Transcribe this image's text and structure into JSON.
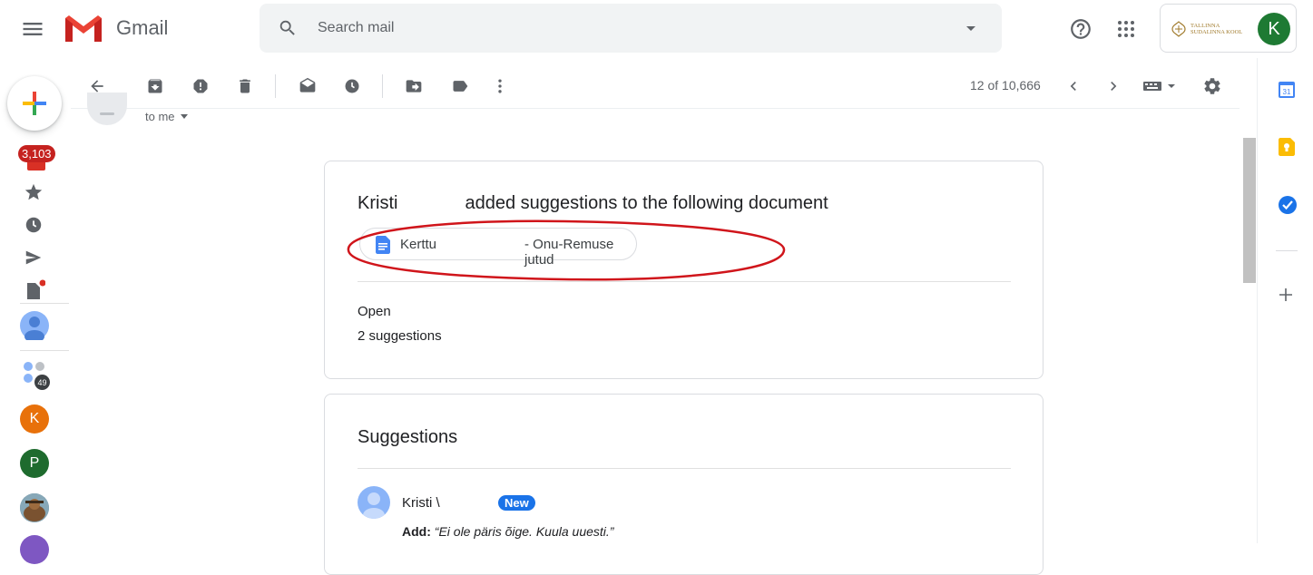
{
  "app": {
    "name": "Gmail",
    "brand_red": "#EA4335",
    "accent_blue": "#1a73e8"
  },
  "header": {
    "logo_text": "Gmail",
    "search_placeholder": "Search mail",
    "icons": [
      "main-menu-icon",
      "search-icon",
      "search-options-icon",
      "help-icon",
      "apps-icon"
    ],
    "org_logo_line1": "TALLINNA",
    "org_logo_line2": "SUDALINNA KOOL",
    "avatar_letter": "K",
    "avatar_color": "#1e7a33"
  },
  "left_rail": {
    "inbox_count": "3,103",
    "contacts": [
      {
        "letter": "K",
        "color": "#e8710a"
      },
      {
        "letter": "P",
        "color": "#1e6b2e"
      }
    ],
    "group_count": "49"
  },
  "toolbar": {
    "page_count": "12 of 10,666"
  },
  "message": {
    "to_label": "to me"
  },
  "notification": {
    "sender": "Kristi",
    "action_text": "added suggestions to the following document",
    "doc_name_part1": "Kerttu",
    "doc_name_part2": "- Onu-Remuse jutud",
    "open_label": "Open",
    "suggestions_count": "2 suggestions"
  },
  "suggestions_card": {
    "title": "Suggestions",
    "author": "Kristi \\",
    "badge": "New",
    "add_label": "Add:",
    "add_text": "“Ei ole päris õige. Kuula uuesti.”"
  }
}
